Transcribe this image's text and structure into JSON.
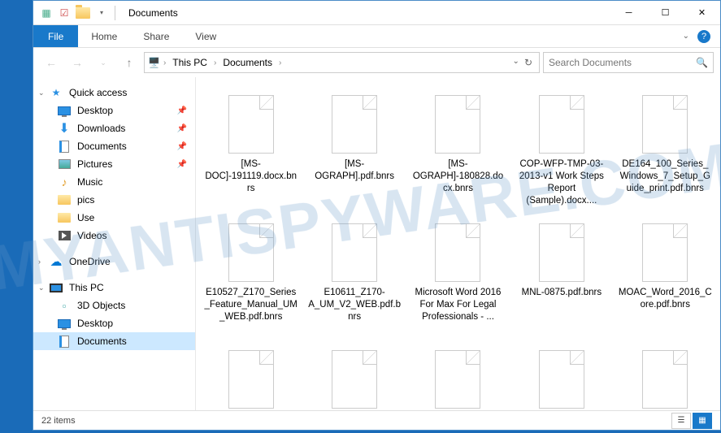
{
  "watermark": "MYANTISPYWARE.COM",
  "window_title": "Documents",
  "ribbon": {
    "file": "File",
    "tabs": [
      "Home",
      "Share",
      "View"
    ]
  },
  "breadcrumb": {
    "segments": [
      "This PC",
      "Documents"
    ]
  },
  "search": {
    "placeholder": "Search Documents"
  },
  "sidebar": {
    "quick_access": "Quick access",
    "items": [
      {
        "label": "Desktop",
        "pin": true,
        "icon": "desktop"
      },
      {
        "label": "Downloads",
        "pin": true,
        "icon": "down"
      },
      {
        "label": "Documents",
        "pin": true,
        "icon": "doc"
      },
      {
        "label": "Pictures",
        "pin": true,
        "icon": "pic"
      },
      {
        "label": "Music",
        "pin": false,
        "icon": "music"
      },
      {
        "label": "pics",
        "pin": false,
        "icon": "folder"
      },
      {
        "label": "Use",
        "pin": false,
        "icon": "folder"
      },
      {
        "label": "Videos",
        "pin": false,
        "icon": "video"
      }
    ],
    "onedrive": "OneDrive",
    "this_pc": "This PC",
    "pc_items": [
      {
        "label": "3D Objects",
        "icon": "3d"
      },
      {
        "label": "Desktop",
        "icon": "desktop"
      },
      {
        "label": "Documents",
        "icon": "doc",
        "selected": true
      }
    ]
  },
  "files": [
    "[MS-DOC]-191119.docx.bnrs",
    "[MS-OGRAPH].pdf.bnrs",
    "[MS-OGRAPH]-180828.docx.bnrs",
    "COP-WFP-TMP-03-2013-v1 Work Steps Report (Sample).docx....",
    "DE164_100_Series_Windows_7_Setup_Guide_print.pdf.bnrs",
    "E10527_Z170_Series_Feature_Manual_UM_WEB.pdf.bnrs",
    "E10611_Z170-A_UM_V2_WEB.pdf.bnrs",
    "Microsoft Word 2016 For Max For Legal Professionals - ...",
    "MNL-0875.pdf.bnrs",
    "MOAC_Word_2016_Core.pdf.bnrs"
  ],
  "status": {
    "count": "22 items"
  }
}
